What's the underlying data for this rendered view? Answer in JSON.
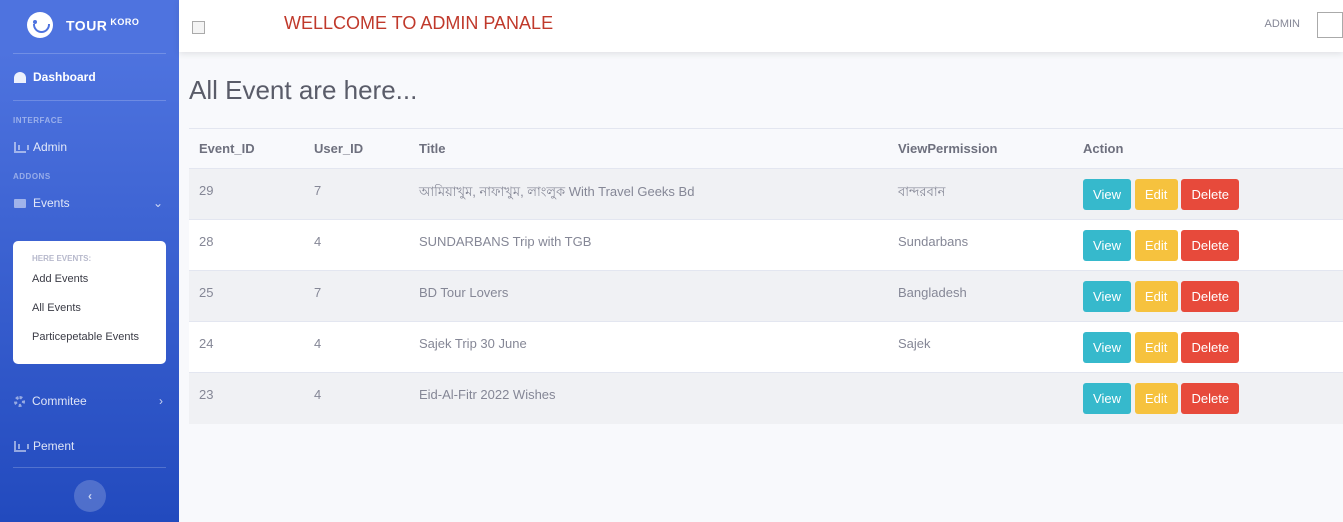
{
  "brand": {
    "name": "TOUR",
    "sup": "KORO"
  },
  "sidebar": {
    "dashboard": "Dashboard",
    "interface_heading": "INTERFACE",
    "admin": "Admin",
    "addons_heading": "ADDONS",
    "events": "Events",
    "submenu": {
      "heading": "HERE EVENTS:",
      "items": [
        "Add Events",
        "All Events",
        "Particepetable Events"
      ]
    },
    "commitee": "Commitee",
    "pement": "Pement",
    "toggle": "‹"
  },
  "topbar": {
    "welcome": "WELLCOME TO ADMIN PANALE",
    "admin_label": "ADMIN"
  },
  "page": {
    "title": "All Event are here..."
  },
  "table": {
    "headers": [
      "Event_ID",
      "User_ID",
      "Title",
      "ViewPermission",
      "Action"
    ],
    "rows": [
      {
        "event_id": "29",
        "user_id": "7",
        "title": "আমিয়াখুম, নাফাখুম, লাংলুক With Travel Geeks Bd",
        "view_permission": "বান্দরবান"
      },
      {
        "event_id": "28",
        "user_id": "4",
        "title": "SUNDARBANS Trip with TGB",
        "view_permission": "Sundarbans"
      },
      {
        "event_id": "25",
        "user_id": "7",
        "title": "BD Tour Lovers",
        "view_permission": "Bangladesh"
      },
      {
        "event_id": "24",
        "user_id": "4",
        "title": "Sajek Trip 30 June",
        "view_permission": "Sajek"
      },
      {
        "event_id": "23",
        "user_id": "4",
        "title": "Eid-Al-Fitr 2022 Wishes",
        "view_permission": ""
      }
    ],
    "actions": {
      "view": "View",
      "edit": "Edit",
      "delete": "Delete"
    }
  },
  "colors": {
    "sidebar": "#4e73df",
    "view": "#36b9cc",
    "edit": "#f6c23e",
    "delete": "#e74a3b",
    "welcome": "#c0392b"
  }
}
